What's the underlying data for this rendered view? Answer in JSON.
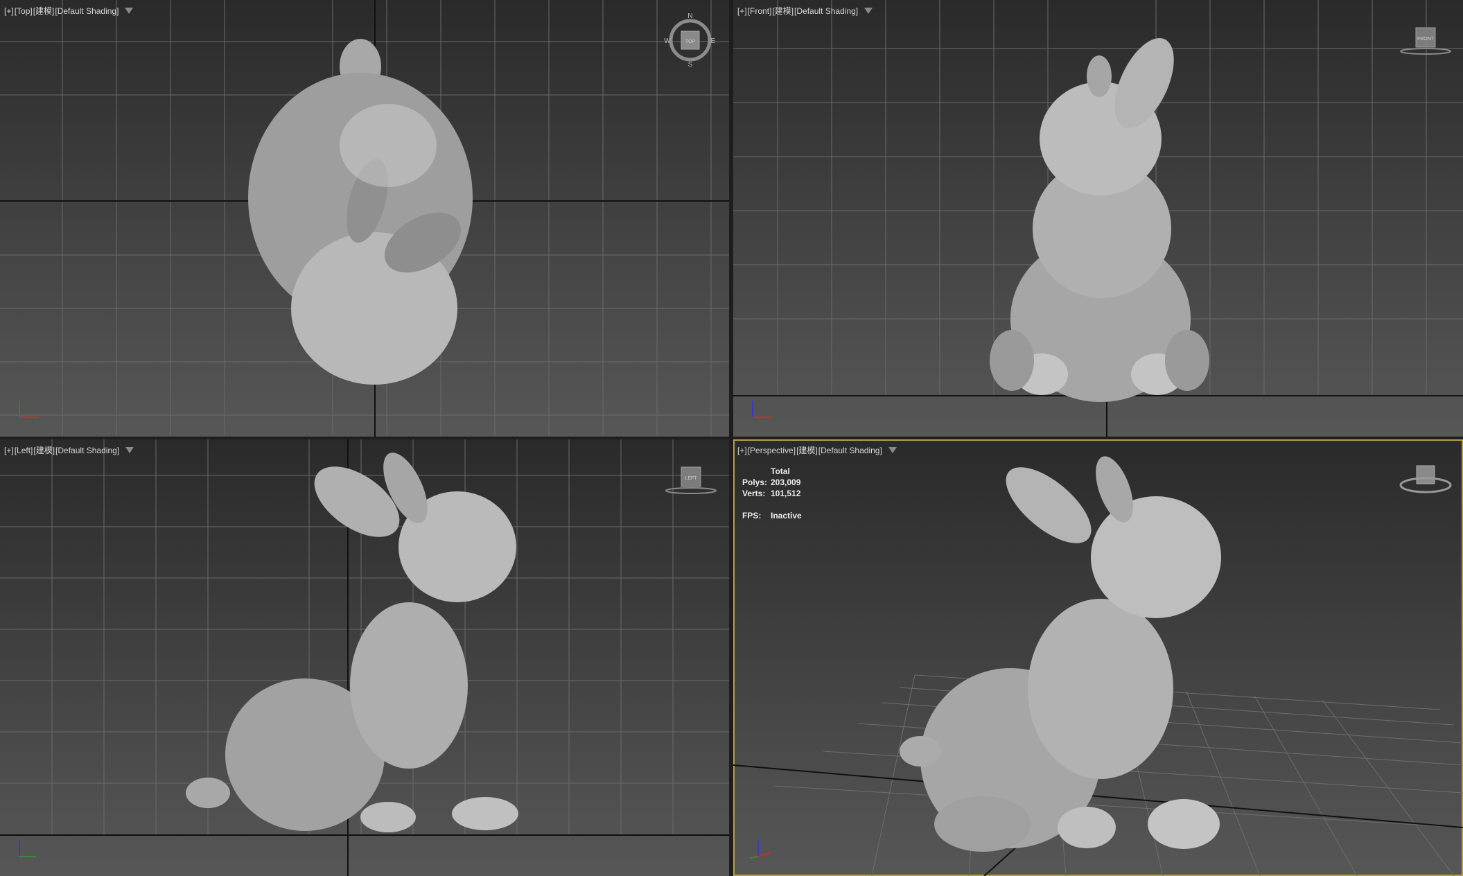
{
  "viewports": {
    "top": {
      "plus": "[+]",
      "view": "[Top]",
      "mode": "[建模]",
      "shading": "[Default Shading]",
      "navcube": "TOP",
      "compass": {
        "n": "N",
        "s": "S",
        "e": "E",
        "w": "W"
      }
    },
    "front": {
      "plus": "[+]",
      "view": "[Front]",
      "mode": "[建模]",
      "shading": "[Default Shading]",
      "navcube": "FRONT"
    },
    "left": {
      "plus": "[+]",
      "view": "[Left]",
      "mode": "[建模]",
      "shading": "[Default Shading]",
      "navcube": "LEFT"
    },
    "perspective": {
      "plus": "[+]",
      "view": "[Perspective]",
      "mode": "[建模]",
      "shading": "[Default Shading]",
      "active": true
    }
  },
  "stats": {
    "header": "Total",
    "polys_label": "Polys:",
    "polys_value": "203,009",
    "verts_label": "Verts:",
    "verts_value": "101,512",
    "fps_label": "FPS:",
    "fps_value": "Inactive"
  },
  "colors": {
    "active_border": "#b8a040",
    "grid": "#6e6e6e",
    "model": "#b4b4b4"
  },
  "icons": [
    "filter-icon",
    "viewcube-icon",
    "compass-icon",
    "axis-tripod-icon",
    "bunny-model"
  ]
}
